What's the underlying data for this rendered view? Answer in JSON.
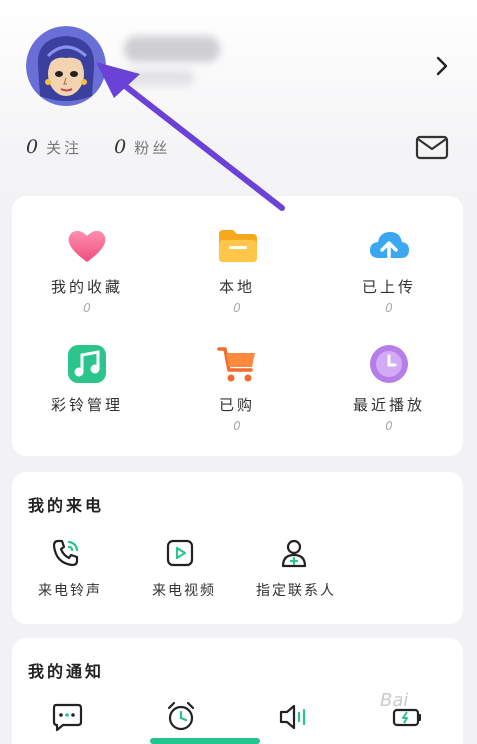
{
  "profile": {
    "follow_count": "0",
    "follow_label": "关注",
    "fans_count": "0",
    "fans_label": "粉丝"
  },
  "grid": [
    {
      "label": "我的收藏",
      "count": "0",
      "icon": "heart-icon"
    },
    {
      "label": "本地",
      "count": "0",
      "icon": "folder-icon"
    },
    {
      "label": "已上传",
      "count": "0",
      "icon": "cloud-upload-icon"
    },
    {
      "label": "彩铃管理",
      "count": "",
      "icon": "music-note-icon"
    },
    {
      "label": "已购",
      "count": "0",
      "icon": "cart-icon"
    },
    {
      "label": "最近播放",
      "count": "0",
      "icon": "clock-icon"
    }
  ],
  "incoming": {
    "title": "我的来电",
    "items": [
      {
        "label": "来电铃声",
        "icon": "phone-ring-icon"
      },
      {
        "label": "来电视频",
        "icon": "video-play-icon"
      },
      {
        "label": "指定联系人",
        "icon": "contact-add-icon"
      }
    ]
  },
  "notify": {
    "title": "我的通知",
    "items": [
      {
        "icon": "message-icon"
      },
      {
        "icon": "alarm-clock-icon"
      },
      {
        "icon": "speaker-icon"
      },
      {
        "icon": "battery-icon"
      }
    ]
  },
  "watermark": "Bai"
}
